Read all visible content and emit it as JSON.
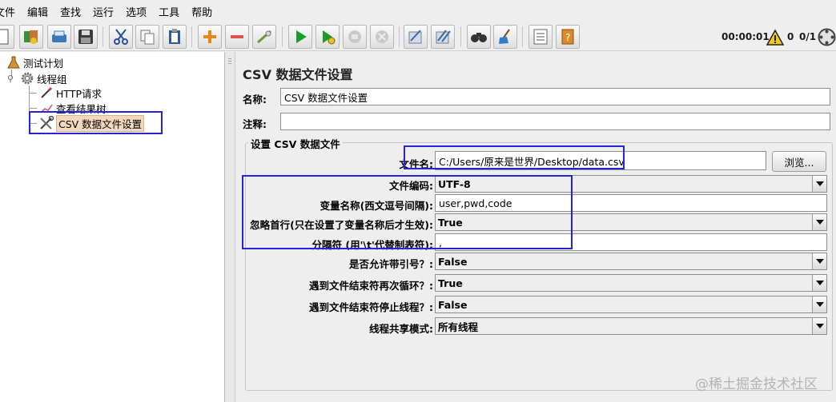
{
  "menu": [
    "文件",
    "编辑",
    "查找",
    "运行",
    "选项",
    "工具",
    "帮助"
  ],
  "toolbar": {
    "buttons": [
      "new-icon",
      "templates-icon",
      "open-icon",
      "save-icon",
      "cut-icon",
      "copy-icon",
      "paste-icon",
      "expand-icon",
      "collapse-icon",
      "toggle-icon",
      "start-icon",
      "start-no-pauses-icon",
      "stop-icon",
      "shutdown-icon",
      "clear-icon",
      "clear-all-icon",
      "search-icon",
      "reset-search-icon",
      "function-helper-icon",
      "help-icon"
    ],
    "timer": "00:00:01",
    "warnings": "0",
    "threads": "0/1"
  },
  "tree": {
    "test_plan": "测试计划",
    "thread_group": "线程组",
    "http_request": "HTTP请求",
    "view_results_tree": "查看结果树",
    "csv_data_set": "CSV 数据文件设置"
  },
  "panel": {
    "title": "CSV 数据文件设置",
    "name_label": "名称:",
    "name_value": "CSV 数据文件设置",
    "comment_label": "注释:",
    "comment_value": "",
    "group_title": "设置 CSV 数据文件",
    "filename_label": "文件名:",
    "filename_value": "C:/Users/原来是世界/Desktop/data.csv",
    "browse_label": "浏览...",
    "encoding_label": "文件编码:",
    "encoding_value": "UTF-8",
    "varnames_label": "变量名称(西文逗号间隔):",
    "varnames_value": "user,pwd,code",
    "ignore_first_label": "忽略首行(只在设置了变量名称后才生效):",
    "ignore_first_value": "True",
    "delimiter_label": "分隔符 (用'\\t'代替制表符):",
    "delimiter_value": ",",
    "quoted_label": "是否允许带引号？:",
    "quoted_value": "False",
    "recycle_label": "遇到文件结束符再次循环？:",
    "recycle_value": "True",
    "stop_thread_label": "遇到文件结束符停止线程？:",
    "stop_thread_value": "False",
    "sharing_label": "线程共享模式:",
    "sharing_value": "所有线程"
  },
  "colors": {
    "highlight": "#2525d6",
    "selected_node": "#f2d9bd",
    "start_green": "#1a9c2a"
  },
  "watermark": "@稀土掘金技术社区"
}
